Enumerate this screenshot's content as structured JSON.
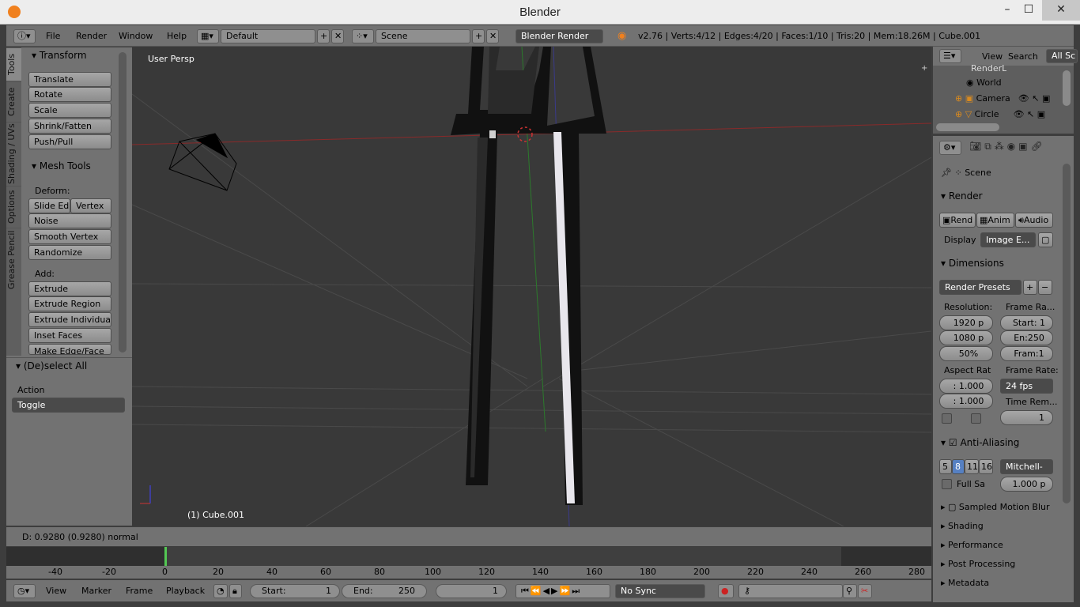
{
  "window": {
    "title": "Blender",
    "minimize": "–",
    "maximize": "☐",
    "close": "✕"
  },
  "topbar": {
    "menus": [
      "File",
      "Render",
      "Window",
      "Help"
    ],
    "layout": "Default",
    "scene": "Scene",
    "engine": "Blender Render",
    "stats": "v2.76 | Verts:4/12 | Edges:4/20 | Faces:1/10 | Tris:20 | Mem:18.26M | Cube.001"
  },
  "toolshelf": {
    "tabs": [
      "Tools",
      "Create",
      "Shading / UVs",
      "Options",
      "Grease Pencil"
    ],
    "transform": {
      "header": "Transform",
      "buttons": [
        "Translate",
        "Rotate",
        "Scale",
        "Shrink/Fatten",
        "Push/Pull"
      ]
    },
    "mesh_tools": {
      "header": "Mesh Tools",
      "deform_label": "Deform:",
      "slide_edge": "Slide Ed",
      "vertex": "Vertex",
      "deform_buttons": [
        "Noise",
        "Smooth Vertex",
        "Randomize"
      ],
      "add_label": "Add:",
      "extrude": "Extrude",
      "add_buttons": [
        "Extrude Region",
        "Extrude Individual",
        "Inset Faces",
        "Make Edge/Face"
      ]
    },
    "operator": {
      "header": "(De)select All",
      "action_label": "Action",
      "action_value": "Toggle"
    }
  },
  "viewport": {
    "view_label": "User Persp",
    "object_label": "(1) Cube.001"
  },
  "status": {
    "text": "D: 0.9280 (0.9280) normal"
  },
  "timeline": {
    "ticks": [
      "-40",
      "-20",
      "0",
      "20",
      "40",
      "60",
      "80",
      "100",
      "120",
      "140",
      "160",
      "180",
      "200",
      "220",
      "240",
      "260",
      "280"
    ]
  },
  "bottombar": {
    "menus": [
      "View",
      "Marker",
      "Frame",
      "Playback"
    ],
    "start_label": "Start:",
    "start_value": "1",
    "end_label": "End:",
    "end_value": "250",
    "current_frame": "1",
    "sync": "No Sync"
  },
  "outliner": {
    "view": "View",
    "search": "Search",
    "all_scenes": "All Sc",
    "items": [
      "RenderL",
      "World",
      "Camera",
      "Circle"
    ]
  },
  "properties": {
    "scene": "Scene",
    "render": {
      "header": "Render",
      "rend": "Rend",
      "anim": "Anim",
      "audio": "Audio",
      "display_label": "Display",
      "display_value": "Image E..."
    },
    "dimensions": {
      "header": "Dimensions",
      "presets": "Render Presets",
      "resolution_label": "Resolution:",
      "res_x": "1920 p",
      "res_y": "1080 p",
      "res_pct": "50%",
      "frame_range_label": "Frame Ra...",
      "frame_start": "Start: 1",
      "frame_end": "En:250",
      "frame_step": "Fram:1",
      "aspect_label": "Aspect Rat",
      "aspect_x": ": 1.000",
      "aspect_y": ": 1.000",
      "frame_rate_label": "Frame Rate:",
      "fps": "24 fps",
      "time_remap_label": "Time Rem...",
      "time_remap_value": "1"
    },
    "anti_aliasing": {
      "header": "Anti-Aliasing",
      "samples": [
        "5",
        "8",
        "11",
        "16"
      ],
      "filter": "Mitchell-",
      "full_sample": "Full Sa",
      "filter_size": "1.000 p"
    },
    "collapsed": [
      "Sampled Motion Blur",
      "Shading",
      "Performance",
      "Post Processing",
      "Metadata"
    ]
  }
}
